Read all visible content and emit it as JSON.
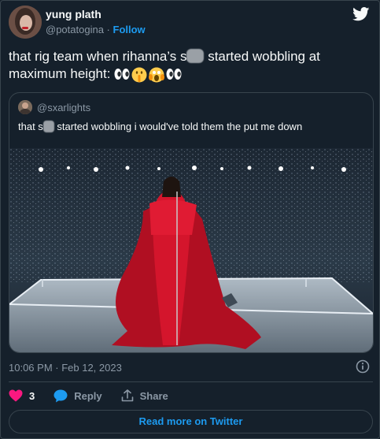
{
  "author": {
    "name": "yung plath",
    "handle": "@potatogina",
    "separator": "·",
    "follow_label": "Follow"
  },
  "tweet": {
    "text_part1": "that rig team when rihanna’s s",
    "text_part2": " started wobbling at maximum height: ",
    "emojis": [
      "eyes-emoji",
      "shushing-face-emoji",
      "screaming-face-emoji",
      "eyes-emoji"
    ]
  },
  "quote": {
    "handle": "@sxarlights",
    "text_part1": "that s",
    "text_part2": " started wobbling i would've told them the put me down"
  },
  "meta": {
    "timestamp": "10:06 PM · Feb 12, 2023"
  },
  "actions": {
    "like_count": "3",
    "reply_label": "Reply",
    "share_label": "Share"
  },
  "footer": {
    "read_more_label": "Read more on Twitter"
  },
  "colors": {
    "background": "#15202b",
    "border": "#38444d",
    "accent": "#1d9bf0",
    "like": "#f91880",
    "muted": "#8b98a5",
    "dress": "#c8102e"
  }
}
